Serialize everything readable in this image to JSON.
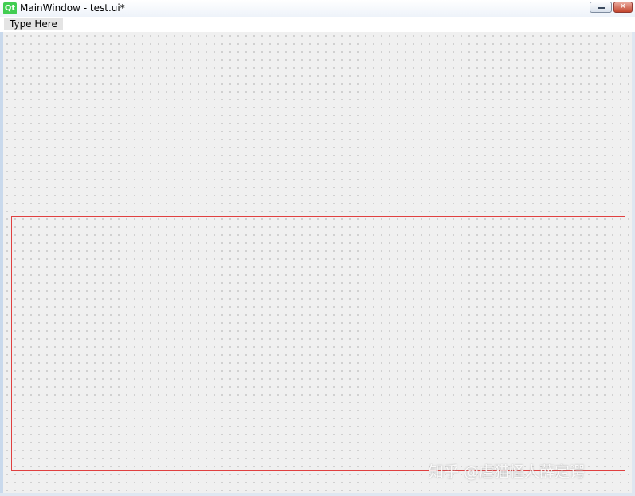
{
  "window": {
    "title": "MainWindow - test.ui*",
    "logo_text": "Qt",
    "close_glyph": "✕"
  },
  "menubar": {
    "items": [
      {
        "label": "Type Here"
      }
    ]
  },
  "watermark": {
    "text": "知乎 @虐猫怪人薛定谔"
  },
  "colors": {
    "qt_green": "#41cd52",
    "selection_border": "#e04040",
    "canvas_bg": "#f0f0f0",
    "grid_dot": "#7a7a7a"
  },
  "icons": {
    "app": "qt-logo-icon",
    "minimize": "minimize-icon",
    "close": "close-icon"
  }
}
